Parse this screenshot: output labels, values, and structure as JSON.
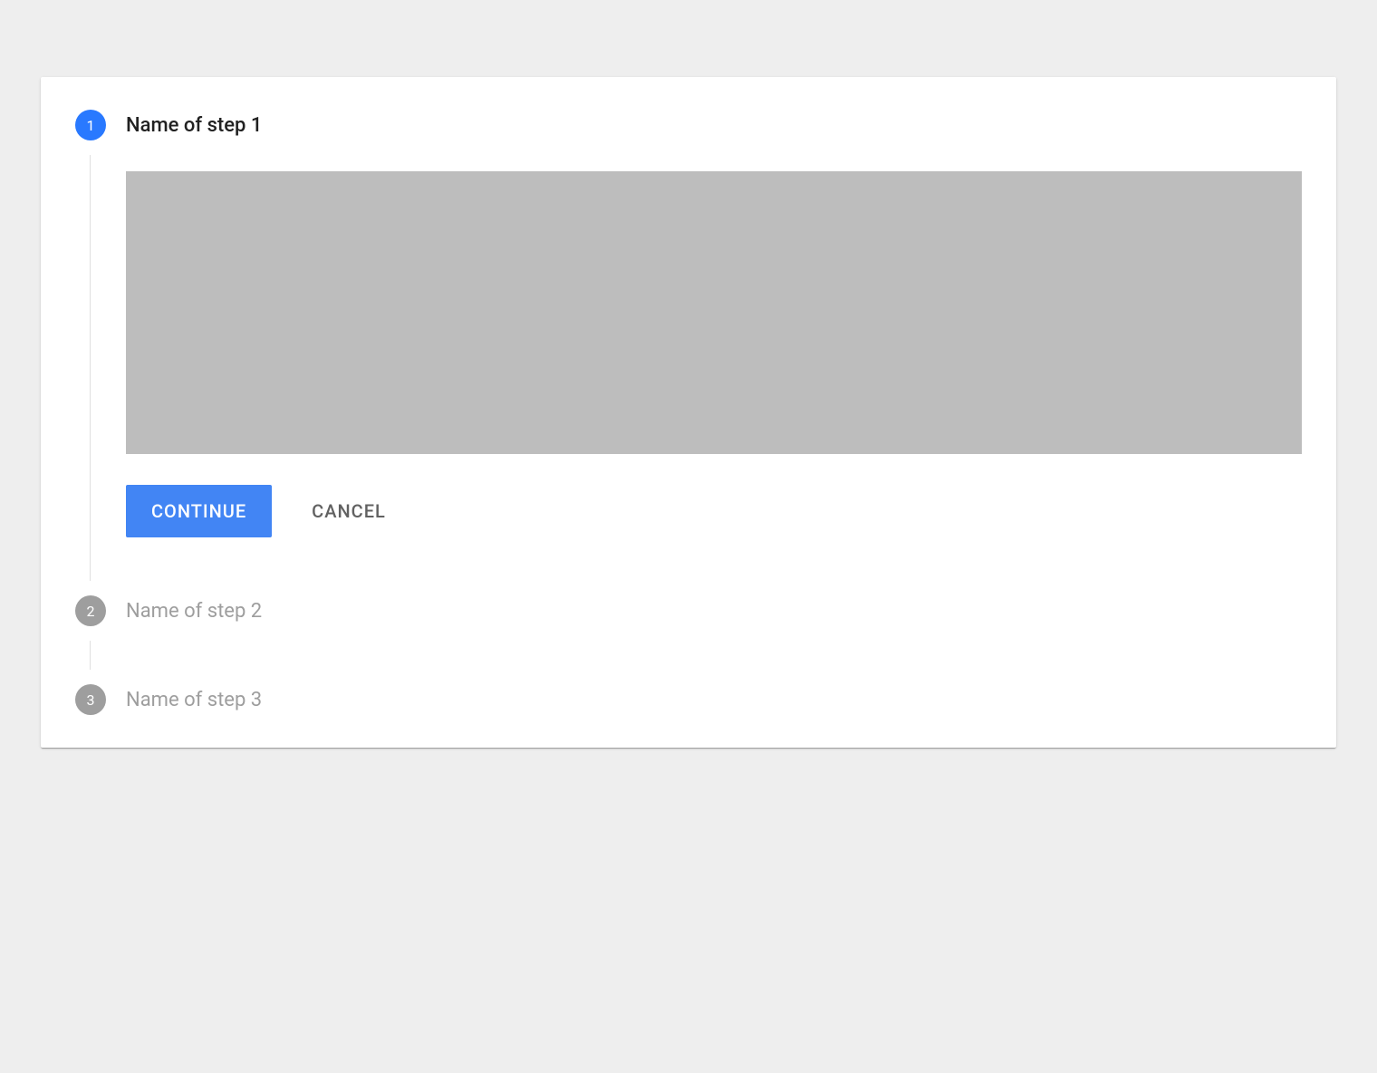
{
  "stepper": {
    "steps": [
      {
        "number": "1",
        "label": "Name of step 1",
        "active": true
      },
      {
        "number": "2",
        "label": "Name of step 2",
        "active": false
      },
      {
        "number": "3",
        "label": "Name of step 3",
        "active": false
      }
    ],
    "actions": {
      "continue_label": "CONTINUE",
      "cancel_label": "CANCEL"
    }
  }
}
